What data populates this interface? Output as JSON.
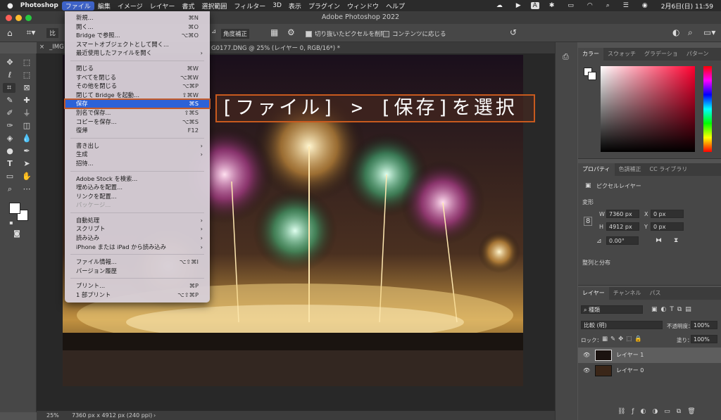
{
  "mac_menubar": {
    "app": "Photoshop",
    "items": [
      "ファイル",
      "編集",
      "イメージ",
      "レイヤー",
      "書式",
      "選択範囲",
      "フィルター",
      "3D",
      "表示",
      "プラグイン",
      "ウィンドウ",
      "ヘルプ"
    ],
    "clock": "2月6日(日)  11:59",
    "input_indicator": "A"
  },
  "window": {
    "title": "Adobe Photoshop 2022"
  },
  "options_bar": {
    "straighten_label": "角度補正",
    "delete_cropped_label": "切り抜いたピクセルを削除",
    "content_aware_label": "コンテンツに応じる",
    "ratio_fragment": "比"
  },
  "document": {
    "tab_left": "_IMG",
    "tab_title": "G0177.DNG @ 25% (レイヤー 0, RGB/16*) *",
    "zoom": "25%",
    "dimensions": "7360 px x 4912 px (240 ppi)"
  },
  "file_menu": {
    "groups": [
      [
        {
          "label": "新規...",
          "shortcut": "⌘N"
        },
        {
          "label": "開く...",
          "shortcut": "⌘O"
        },
        {
          "label": "Bridge で参照...",
          "shortcut": "⌥⌘O"
        },
        {
          "label": "スマートオブジェクトとして開く...",
          "shortcut": ""
        },
        {
          "label": "最近使用したファイルを開く",
          "shortcut": "",
          "submenu": true
        }
      ],
      [
        {
          "label": "閉じる",
          "shortcut": "⌘W"
        },
        {
          "label": "すべてを閉じる",
          "shortcut": "⌥⌘W"
        },
        {
          "label": "その他を閉じる",
          "shortcut": "⌥⌘P"
        },
        {
          "label": "閉じて Bridge を起動...",
          "shortcut": "⇧⌘W"
        },
        {
          "label": "保存",
          "shortcut": "⌘S",
          "highlight": true
        },
        {
          "label": "別名で保存...",
          "shortcut": "⇧⌘S"
        },
        {
          "label": "コピーを保存...",
          "shortcut": "⌥⌘S"
        },
        {
          "label": "復帰",
          "shortcut": "F12"
        }
      ],
      [
        {
          "label": "書き出し",
          "shortcut": "",
          "submenu": true
        },
        {
          "label": "生成",
          "shortcut": "",
          "submenu": true
        },
        {
          "label": "招待...",
          "shortcut": ""
        }
      ],
      [
        {
          "label": "Adobe Stock を検索...",
          "shortcut": ""
        },
        {
          "label": "埋め込みを配置...",
          "shortcut": ""
        },
        {
          "label": "リンクを配置...",
          "shortcut": ""
        },
        {
          "label": "パッケージ...",
          "shortcut": "",
          "disabled": true
        }
      ],
      [
        {
          "label": "自動処理",
          "shortcut": "",
          "submenu": true
        },
        {
          "label": "スクリプト",
          "shortcut": "",
          "submenu": true
        },
        {
          "label": "読み込み",
          "shortcut": "",
          "submenu": true
        },
        {
          "label": "iPhone または iPad から読み込み",
          "shortcut": "",
          "submenu": true
        }
      ],
      [
        {
          "label": "ファイル情報...",
          "shortcut": "⌥⇧⌘I"
        },
        {
          "label": "バージョン履歴",
          "shortcut": ""
        }
      ],
      [
        {
          "label": "プリント...",
          "shortcut": "⌘P"
        },
        {
          "label": "1 部プリント",
          "shortcut": "⌥⇧⌘P"
        }
      ]
    ]
  },
  "callout": {
    "text": "[ファイル] > [保存]を選択"
  },
  "color_panel": {
    "tabs": [
      "カラー",
      "スウォッチ",
      "グラデーショ",
      "パターン"
    ]
  },
  "properties_panel": {
    "tabs": [
      "プロパティ",
      "色調補正",
      "CC ライブラリ"
    ],
    "layer_type": "ピクセルレイヤー",
    "transform_label": "変形",
    "w_label": "W",
    "w_value": "7360 px",
    "h_label": "H",
    "h_value": "4912 px",
    "x_label": "X",
    "x_value": "0 px",
    "y_label": "Y",
    "y_value": "0 px",
    "angle_value": "0.00°",
    "align_label": "整列と分布"
  },
  "layers_panel": {
    "tabs": [
      "レイヤー",
      "チャンネル",
      "パス"
    ],
    "filter_kind": "種類",
    "blend_mode": "比較 (明)",
    "opacity_label": "不透明度：",
    "opacity_value": "100%",
    "lock_label": "ロック：",
    "fill_label": "塗り：",
    "fill_value": "100%",
    "layers": [
      {
        "name": "レイヤー 1",
        "selected": true
      },
      {
        "name": "レイヤー 0",
        "selected": false
      }
    ]
  },
  "colors": {
    "accent": "#2c62d8",
    "callout_border": "#c85a1e"
  }
}
